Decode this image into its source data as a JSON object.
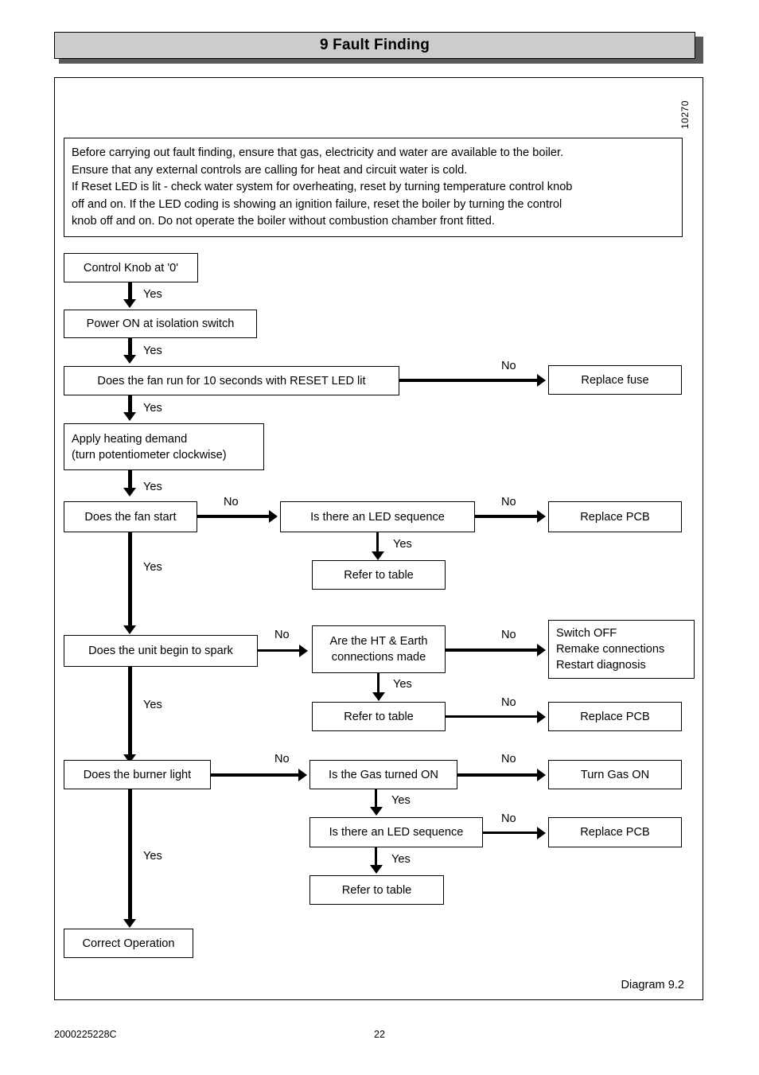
{
  "page": {
    "header_title": "9 Fault Finding",
    "sheet_number": "10270",
    "diagram_caption": "Diagram 9.2",
    "footer_code": "2000225228C",
    "footer_page": "22"
  },
  "warning": {
    "lines": [
      "Before carrying out fault finding, ensure that gas, electricity and water are available to the boiler.",
      "Ensure that any external controls are calling for heat and circuit water is cold.",
      "If Reset LED is lit - check water system for overheating, reset by turning temperature control knob",
      "off and on.  If the LED coding is showing an ignition failure, reset the boiler by turning the control",
      "knob off and on.  Do not operate the boiler without combustion chamber front fitted."
    ]
  },
  "flow": {
    "nodes": {
      "control_knob": "Control Knob at '0'",
      "power_on": "Power ON at isolation switch",
      "fan_run_10s": "Does the fan run for 10 seconds with RESET LED lit",
      "replace_fuse": "Replace fuse",
      "apply_heat_l1": "Apply heating demand",
      "apply_heat_l2": "(turn potentiometer clockwise)",
      "fan_start": "Does the fan start",
      "led_sequence_1": "Is there an LED sequence",
      "replace_pcb_1": "Replace PCB",
      "refer_table_1": "Refer to table",
      "unit_spark": "Does the unit begin to spark",
      "ht_earth_l1": "Are the HT & Earth",
      "ht_earth_l2": "connections made",
      "switch_off_l1": "Switch OFF",
      "switch_off_l2": "Remake connections",
      "switch_off_l3": "Restart diagnosis",
      "refer_table_2": "Refer to table",
      "replace_pcb_2": "Replace PCB",
      "burner_light": "Does the burner light",
      "gas_on": "Is the Gas turned ON",
      "turn_gas_on": "Turn Gas ON",
      "led_sequence_2": "Is there an LED sequence",
      "replace_pcb_3": "Replace PCB",
      "refer_table_3": "Refer to table",
      "correct_operation": "Correct Operation"
    },
    "labels": {
      "yes": "Yes",
      "no": "No"
    }
  }
}
